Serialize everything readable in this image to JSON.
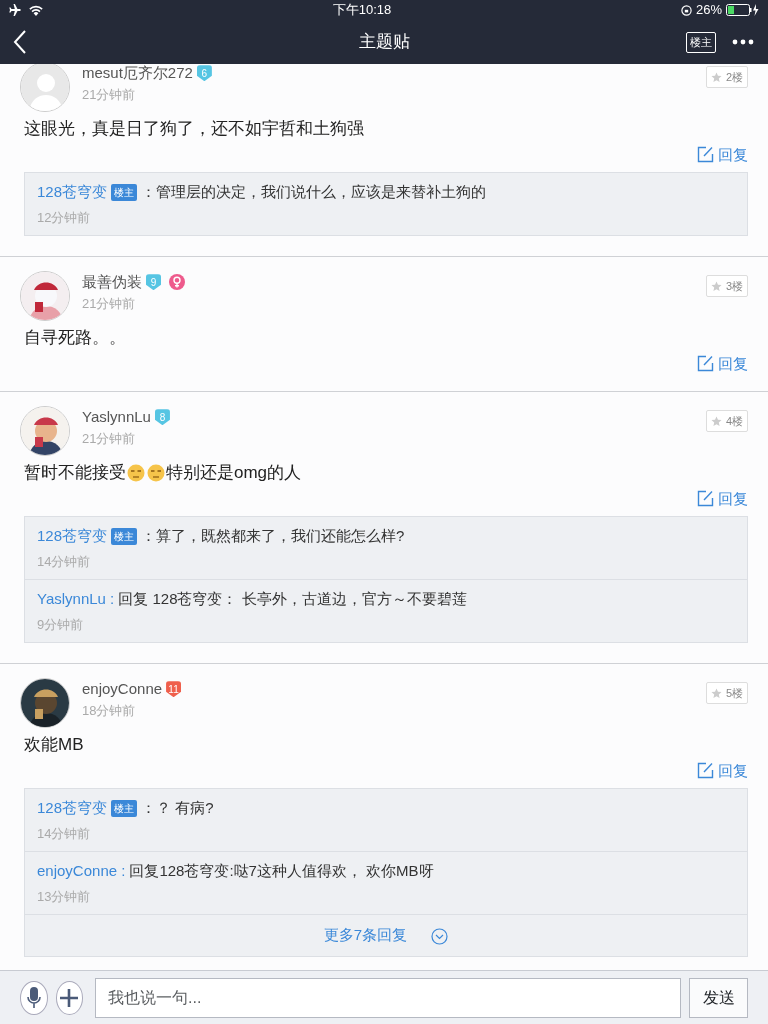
{
  "status_bar": {
    "time": "下午10:18",
    "battery": "26%"
  },
  "nav": {
    "title": "主题贴",
    "op_filter": "楼主"
  },
  "posts": [
    {
      "author": "mesut厄齐尔272",
      "level": "6",
      "color": "#56c5e3",
      "female": false,
      "avatar": {
        "kind": "default"
      },
      "time": "21分钟前",
      "floor": "2楼",
      "body": [
        {
          "kind": "text",
          "text": "这眼光，真是日了狗了，还不如宇哲和土狗强"
        }
      ],
      "reply_label": "回复",
      "replies": [
        {
          "author": "128苍穹变",
          "op": true,
          "op_label": "楼主",
          "text": "：管理层的决定，我们说什么，应该是来替补土狗的",
          "time": "12分钟前"
        }
      ]
    },
    {
      "author": "最善伪装",
      "level": "9",
      "color": "#56c5e3",
      "female": true,
      "avatar": {
        "kind": "picture"
      },
      "time": "21分钟前",
      "floor": "3楼",
      "body": [
        {
          "kind": "text",
          "text": "自寻死路。。"
        }
      ],
      "reply_label": "回复"
    },
    {
      "author": "YaslynnLu",
      "level": "8",
      "color": "#56c5e3",
      "female": false,
      "avatar": {
        "kind": "picture"
      },
      "time": "21分钟前",
      "floor": "4楼",
      "body": [
        {
          "kind": "text",
          "text": "暂时不能接受"
        },
        {
          "kind": "emoji"
        },
        {
          "kind": "emoji"
        },
        {
          "kind": "text",
          "text": "特别还是omg的人"
        }
      ],
      "reply_label": "回复",
      "replies": [
        {
          "author": "128苍穹变",
          "op": true,
          "op_label": "楼主",
          "text": "：算了，既然都来了，我们还能怎么样?",
          "time": "14分钟前"
        },
        {
          "author": "YaslynnLu :",
          "op": false,
          "text": "回复 128苍穹变： 长亭外，古道边，官方～不要碧莲",
          "time": "9分钟前"
        }
      ]
    },
    {
      "author": "enjoyConne",
      "level": "11",
      "color": "#ef5f4c",
      "female": false,
      "avatar": {
        "kind": "picture"
      },
      "time": "18分钟前",
      "floor": "5楼",
      "body": [
        {
          "kind": "text",
          "text": "欢能MB"
        }
      ],
      "reply_label": "回复",
      "replies": [
        {
          "author": "128苍穹变",
          "op": true,
          "op_label": "楼主",
          "text": "：？ 有病?",
          "time": "14分钟前"
        },
        {
          "author": "enjoyConne :",
          "op": false,
          "text": "回复128苍穹变:哒7这种人值得欢， 欢你MB呀",
          "time": "13分钟前"
        }
      ],
      "more_replies": "更多7条回复"
    }
  ],
  "composer": {
    "placeholder": "我也说一句...",
    "send": "发送"
  }
}
